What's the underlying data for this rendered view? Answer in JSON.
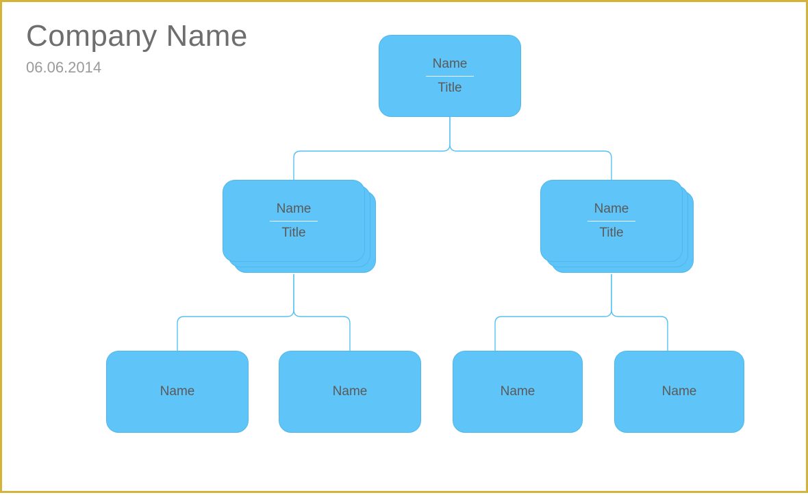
{
  "header": {
    "company": "Company Name",
    "date": "06.06.2014"
  },
  "colors": {
    "node_fill": "#5fc4f7",
    "node_stroke": "#4db7ed",
    "text": "#5a5a5a",
    "frame": "#d7b23a"
  },
  "org": {
    "root": {
      "name": "Name",
      "title": "Title"
    },
    "level2": [
      {
        "name": "Name",
        "title": "Title"
      },
      {
        "name": "Name",
        "title": "Title"
      }
    ],
    "level3": [
      {
        "name": "Name"
      },
      {
        "name": "Name"
      },
      {
        "name": "Name"
      },
      {
        "name": "Name"
      }
    ]
  }
}
